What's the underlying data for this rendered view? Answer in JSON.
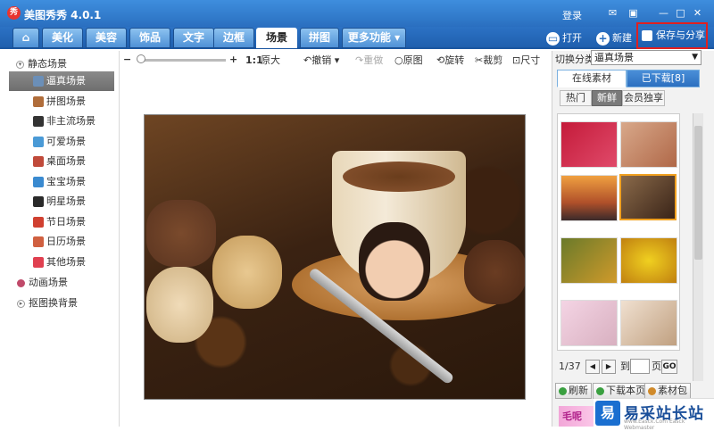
{
  "window": {
    "logo": "秀",
    "title": "美图秀秀 4.0.1",
    "login": "登录"
  },
  "window_buttons": [
    "message-icon",
    "settings-icon",
    "minimize-icon",
    "maximize-icon",
    "close-icon"
  ],
  "tabs": [
    {
      "label": "⌂",
      "icon": "home-icon"
    },
    {
      "label": "美化"
    },
    {
      "label": "美容"
    },
    {
      "label": "饰品"
    },
    {
      "label": "文字"
    },
    {
      "label": "边框"
    },
    {
      "label": "场景",
      "active": true
    },
    {
      "label": "拼图"
    },
    {
      "label": "更多功能 ▾"
    }
  ],
  "top_actions": {
    "open": "打开",
    "new": "新建",
    "save_share": "保存与分享"
  },
  "sidebar": {
    "static_group": "静态场景",
    "items": [
      {
        "label": "逼真场景",
        "selected": true,
        "color": "#6b8fb8"
      },
      {
        "label": "拼图场景",
        "color": "#b06d3a"
      },
      {
        "label": "非主流场景",
        "color": "#333333"
      },
      {
        "label": "可爱场景",
        "color": "#4a9ad6"
      },
      {
        "label": "桌面场景",
        "color": "#c04a3a"
      },
      {
        "label": "宝宝场景",
        "color": "#3a8ad0"
      },
      {
        "label": "明星场景",
        "color": "#2a2a2a"
      },
      {
        "label": "节日场景",
        "color": "#d04030"
      },
      {
        "label": "日历场景",
        "color": "#d06040"
      },
      {
        "label": "其他场景",
        "color": "#e04050"
      }
    ],
    "animated_group": "动画场景",
    "cutout_group": "抠图换背景"
  },
  "toolbar": {
    "zoom_out": "−",
    "zoom_in": "+",
    "ratio": "1:1",
    "original_size": "原大",
    "undo": "撤销",
    "redo": "重做",
    "original": "原图",
    "rotate": "旋转",
    "crop": "裁剪",
    "size": "尺寸"
  },
  "right_panel": {
    "category_label": "切换分类",
    "category_value": "逼真场景",
    "tabs": {
      "online": "在线素材",
      "downloaded": "已下载[8]"
    },
    "subtabs": {
      "hot": "热门",
      "fresh": "新鲜",
      "member": "会员独享"
    },
    "page_info": "1/37",
    "goto_label": "到",
    "page_unit": "页",
    "go": "GO",
    "refresh": "刷新",
    "download_page": "下载本页",
    "material_pack": "素材包",
    "banner": "毛呢"
  },
  "watermark": {
    "logo": "易",
    "text": "易采站长站",
    "sub": "www.Easck.Com  Easck Webmaster"
  }
}
